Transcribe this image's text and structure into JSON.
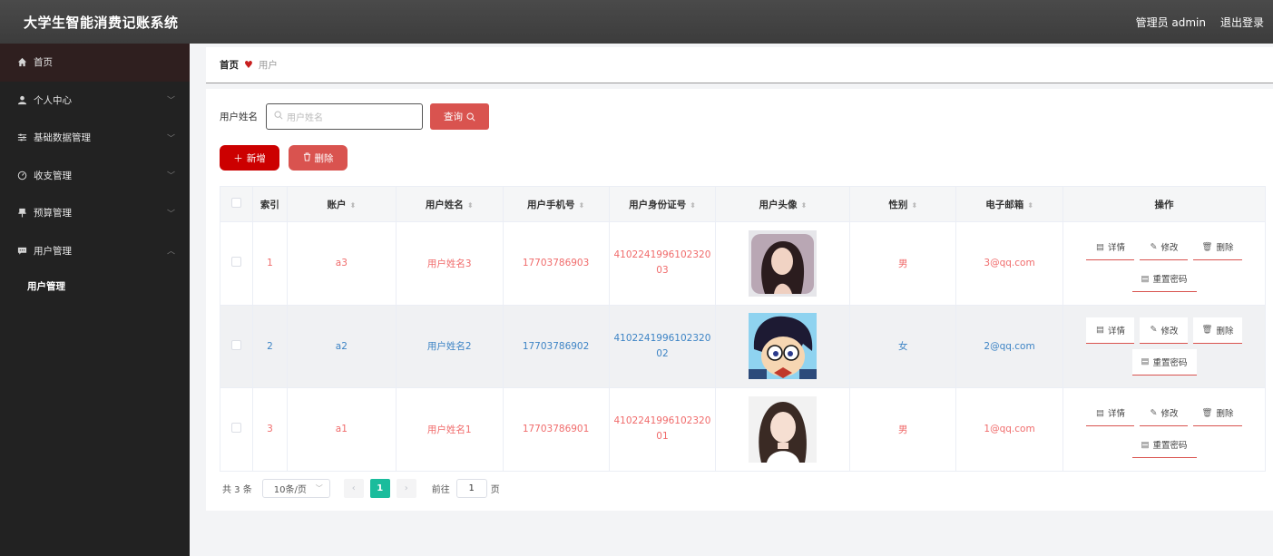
{
  "header": {
    "title": "大学生智能消费记账系统",
    "user_label": "管理员 admin",
    "logout_label": "退出登录"
  },
  "sidebar": {
    "items": [
      {
        "label": "首页",
        "icon": "home-icon"
      },
      {
        "label": "个人中心",
        "icon": "person-icon"
      },
      {
        "label": "基础数据管理",
        "icon": "sliders-icon"
      },
      {
        "label": "收支管理",
        "icon": "gauge-icon"
      },
      {
        "label": "预算管理",
        "icon": "pin-icon"
      },
      {
        "label": "用户管理",
        "icon": "chat-icon"
      }
    ],
    "subitems": [
      {
        "label": "用户管理"
      }
    ]
  },
  "breadcrumb": {
    "home": "首页",
    "current": "用户"
  },
  "search": {
    "label": "用户姓名",
    "placeholder": "用户姓名",
    "button": "查询"
  },
  "actions": {
    "add": "新增",
    "delete": "删除"
  },
  "table": {
    "headers": {
      "index": "索引",
      "account": "账户",
      "name": "用户姓名",
      "phone": "用户手机号",
      "idcard": "用户身份证号",
      "avatar": "用户头像",
      "gender": "性别",
      "email": "电子邮箱",
      "ops": "操作"
    },
    "rows": [
      {
        "index": "1",
        "account": "a3",
        "name": "用户姓名3",
        "phone": "17703786903",
        "idcard": "410224199610232003",
        "gender": "男",
        "email": "3@qq.com"
      },
      {
        "index": "2",
        "account": "a2",
        "name": "用户姓名2",
        "phone": "17703786902",
        "idcard": "410224199610232002",
        "gender": "女",
        "email": "2@qq.com"
      },
      {
        "index": "3",
        "account": "a1",
        "name": "用户姓名1",
        "phone": "17703786901",
        "idcard": "410224199610232001",
        "gender": "男",
        "email": "1@qq.com"
      }
    ],
    "ops": {
      "detail": "详情",
      "edit": "修改",
      "delete": "删除",
      "reset": "重置密码"
    }
  },
  "pagination": {
    "total": "共 3 条",
    "page_size": "10条/页",
    "current_page": "1",
    "goto_label": "前往",
    "goto_value": "1",
    "page_suffix": "页"
  },
  "colors": {
    "header_bg": "#444444",
    "sidebar_bg": "#222222",
    "accent_red": "#d9534f",
    "primary_red": "#cc0000",
    "row_odd_text": "#f06b6b",
    "row_even_text": "#3d84c5",
    "pager_active": "#1abc9c"
  }
}
